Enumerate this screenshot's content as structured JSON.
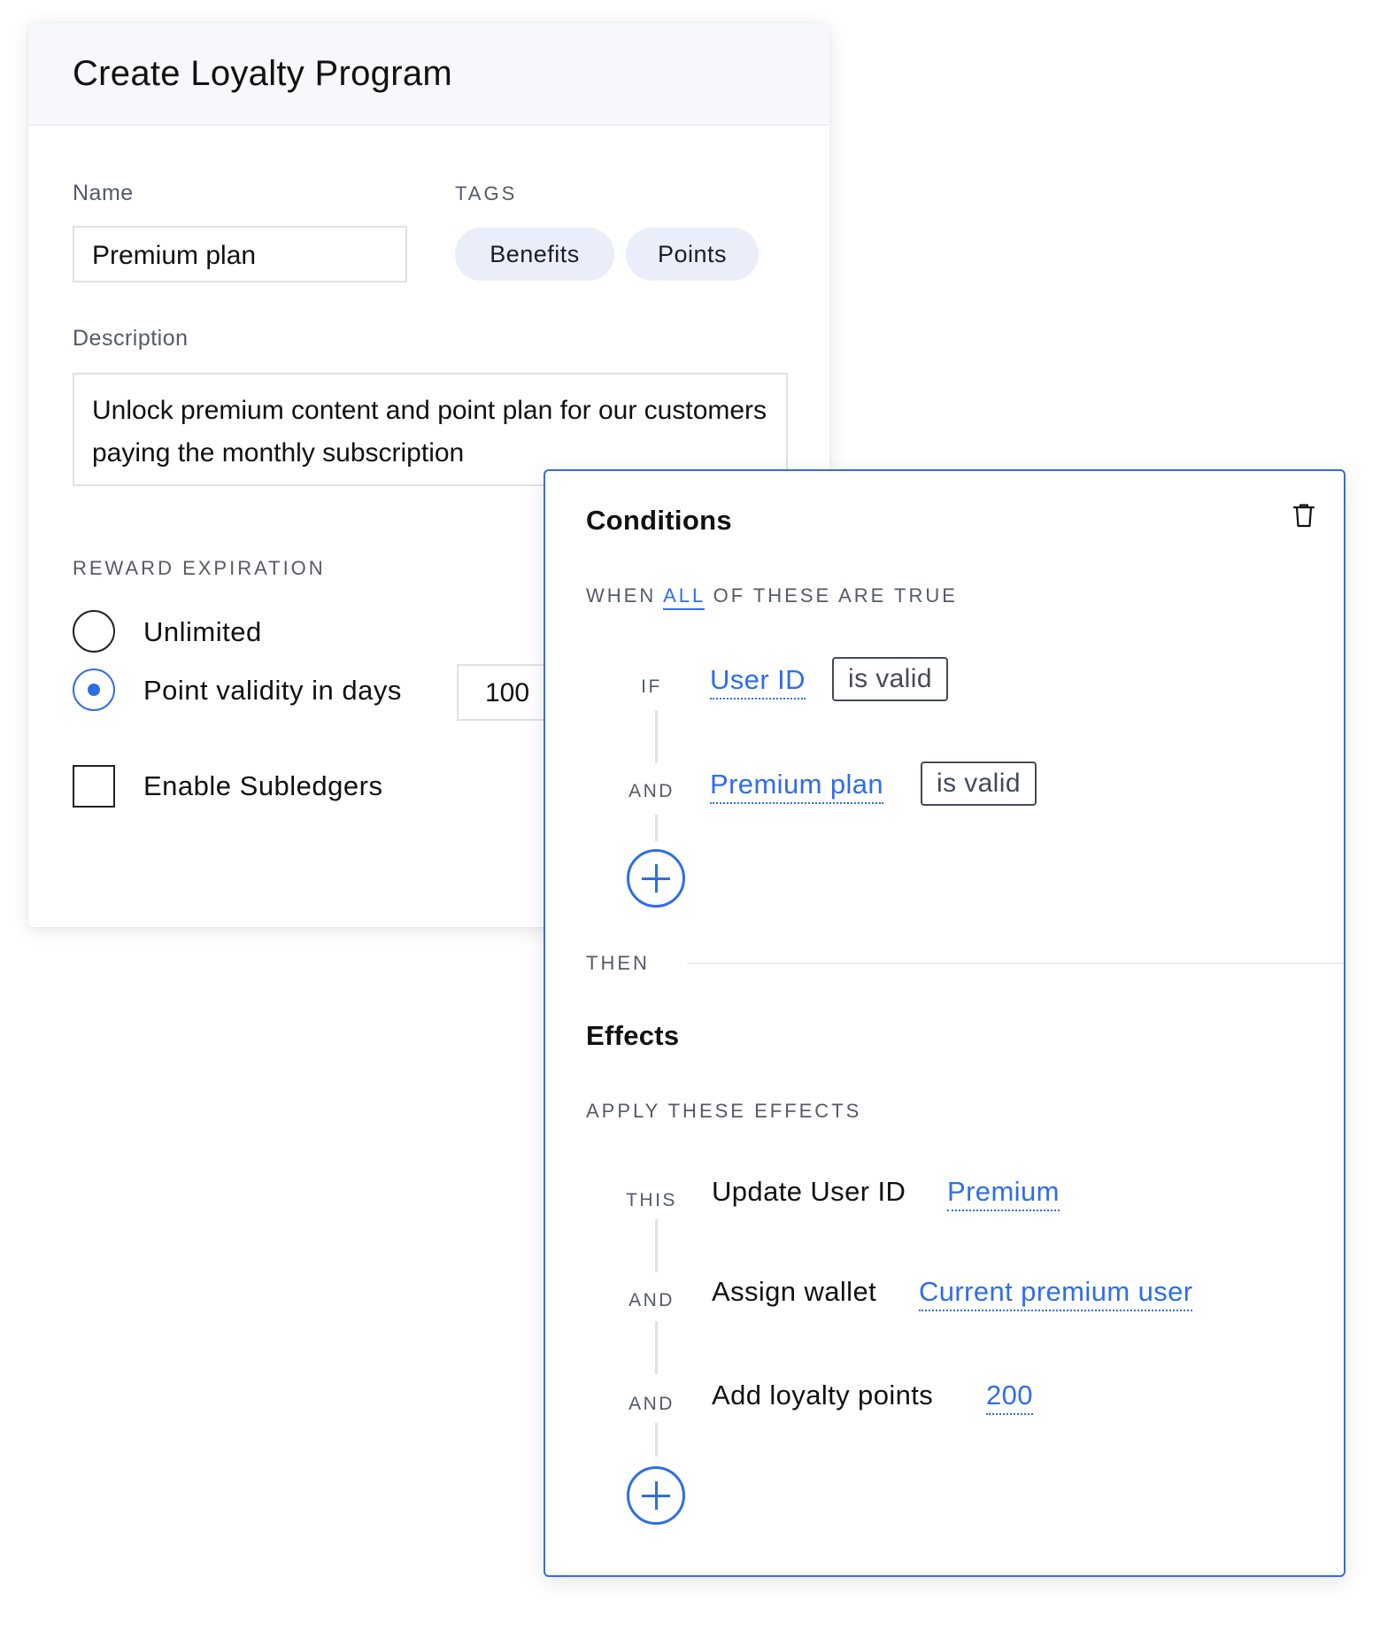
{
  "form": {
    "title": "Create Loyalty Program",
    "name_label": "Name",
    "name_value": "Premium plan",
    "tags_label": "TAGS",
    "tags": [
      "Benefits",
      "Points"
    ],
    "description_label": "Description",
    "description_value": "Unlock premium content and point plan for our customers paying the monthly subscription",
    "reward_expiration_label": "REWARD EXPIRATION",
    "expiration_options": [
      {
        "label": "Unlimited",
        "selected": false
      },
      {
        "label": "Point validity in days",
        "selected": true
      }
    ],
    "validity_days_value": "100",
    "enable_subledgers_label": "Enable Subledgers",
    "enable_subledgers_checked": false
  },
  "conditions": {
    "title": "Conditions",
    "when_prefix": "WHEN",
    "when_quantifier": "ALL",
    "when_suffix": "OF THESE ARE TRUE",
    "rows": [
      {
        "key": "IF",
        "field": "User ID",
        "operator": "is valid"
      },
      {
        "key": "AND",
        "field": "Premium plan",
        "operator": "is valid"
      }
    ],
    "then_label": "THEN"
  },
  "effects": {
    "title": "Effects",
    "subtitle": "APPLY THESE EFFECTS",
    "rows": [
      {
        "key": "THIS",
        "action": "Update User ID",
        "value": "Premium"
      },
      {
        "key": "AND",
        "action": "Assign wallet",
        "value": "Current premium user"
      },
      {
        "key": "AND",
        "action": "Add loyalty points",
        "value": "200"
      }
    ]
  },
  "colors": {
    "accent": "#2f6de8",
    "tag_bg": "#eaeefa",
    "header_bg": "#f7f8fc"
  },
  "icons": [
    "trash-icon",
    "plus-icon",
    "radio-icon",
    "checkbox-icon"
  ]
}
